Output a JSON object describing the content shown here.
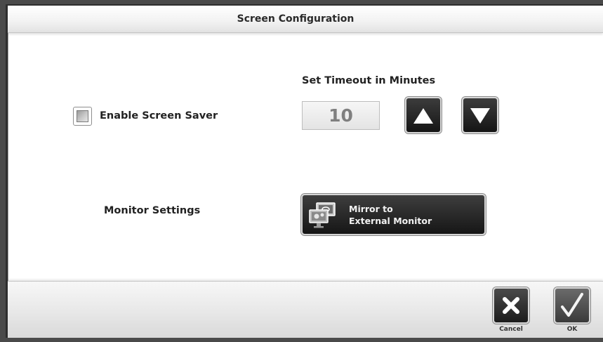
{
  "window": {
    "title": "Screen Configuration"
  },
  "screen_saver": {
    "enable_label": "Enable Screen Saver",
    "enabled": false,
    "timeout_heading": "Set Timeout in Minutes",
    "timeout_value": "10"
  },
  "monitor": {
    "heading": "Monitor Settings",
    "mirror_line1": "Mirror to",
    "mirror_line2": "External Monitor"
  },
  "footer": {
    "cancel_label": "Cancel",
    "ok_label": "OK"
  },
  "icons": {
    "increase": "triangle-up-icon",
    "decrease": "triangle-down-icon",
    "mirror": "monitor-settings-icon",
    "cancel": "x-icon",
    "ok": "checkmark-icon"
  },
  "colors": {
    "button_dark": "#1e1e1e",
    "ok_green": "#3f6b3a",
    "value_text": "#7f7f7f"
  }
}
